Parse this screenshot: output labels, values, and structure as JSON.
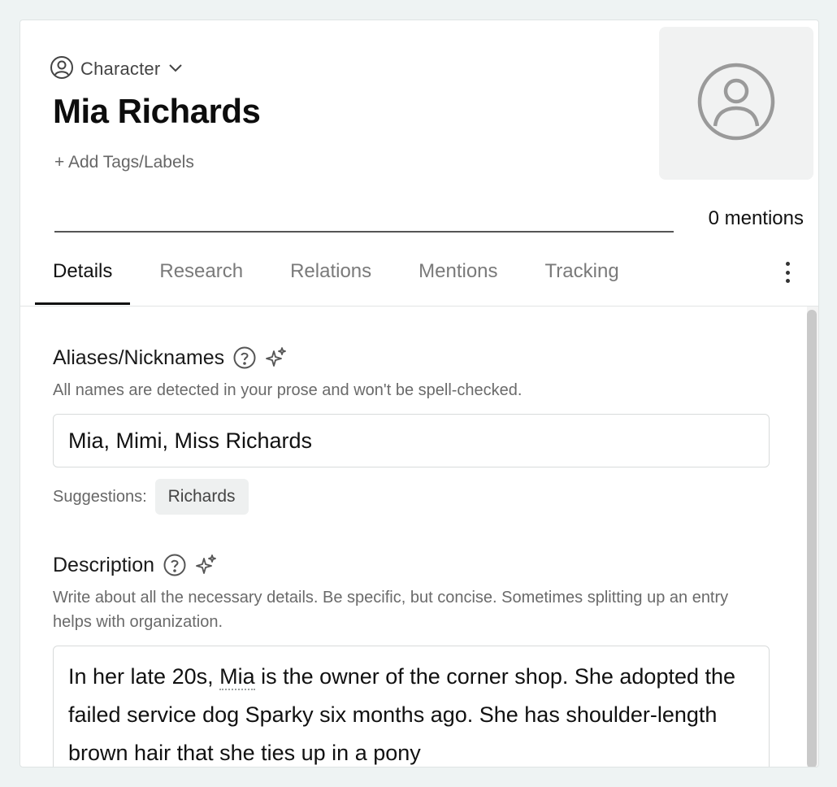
{
  "header": {
    "type_label": "Character",
    "name": "Mia Richards",
    "add_tags_label": "+ Add Tags/Labels",
    "mentions_count": "0 mentions"
  },
  "tabs": [
    {
      "label": "Details",
      "active": true
    },
    {
      "label": "Research",
      "active": false
    },
    {
      "label": "Relations",
      "active": false
    },
    {
      "label": "Mentions",
      "active": false
    },
    {
      "label": "Tracking",
      "active": false
    }
  ],
  "aliases": {
    "title": "Aliases/Nicknames",
    "description": "All names are detected in your prose and won't be spell-checked.",
    "value": "Mia, Mimi, Miss Richards",
    "suggestions_label": "Suggestions:",
    "suggestions": [
      "Richards"
    ]
  },
  "description_field": {
    "title": "Description",
    "description": "Write about all the necessary details. Be specific, but concise. Sometimes splitting up an entry helps with organization.",
    "text_before": "In her late 20s, ",
    "highlight": "Mia",
    "text_after": " is the owner of the corner shop. She adopted the failed service dog Sparky six months ago. She has shoulder-length brown hair that she ties up in a pony"
  },
  "icons": {
    "type": "person-circle-icon",
    "chevron": "chevron-down-icon",
    "avatar": "avatar-placeholder-icon",
    "help": "question-circle-icon",
    "ai": "sparkle-icon",
    "menu": "kebab-menu-icon"
  }
}
